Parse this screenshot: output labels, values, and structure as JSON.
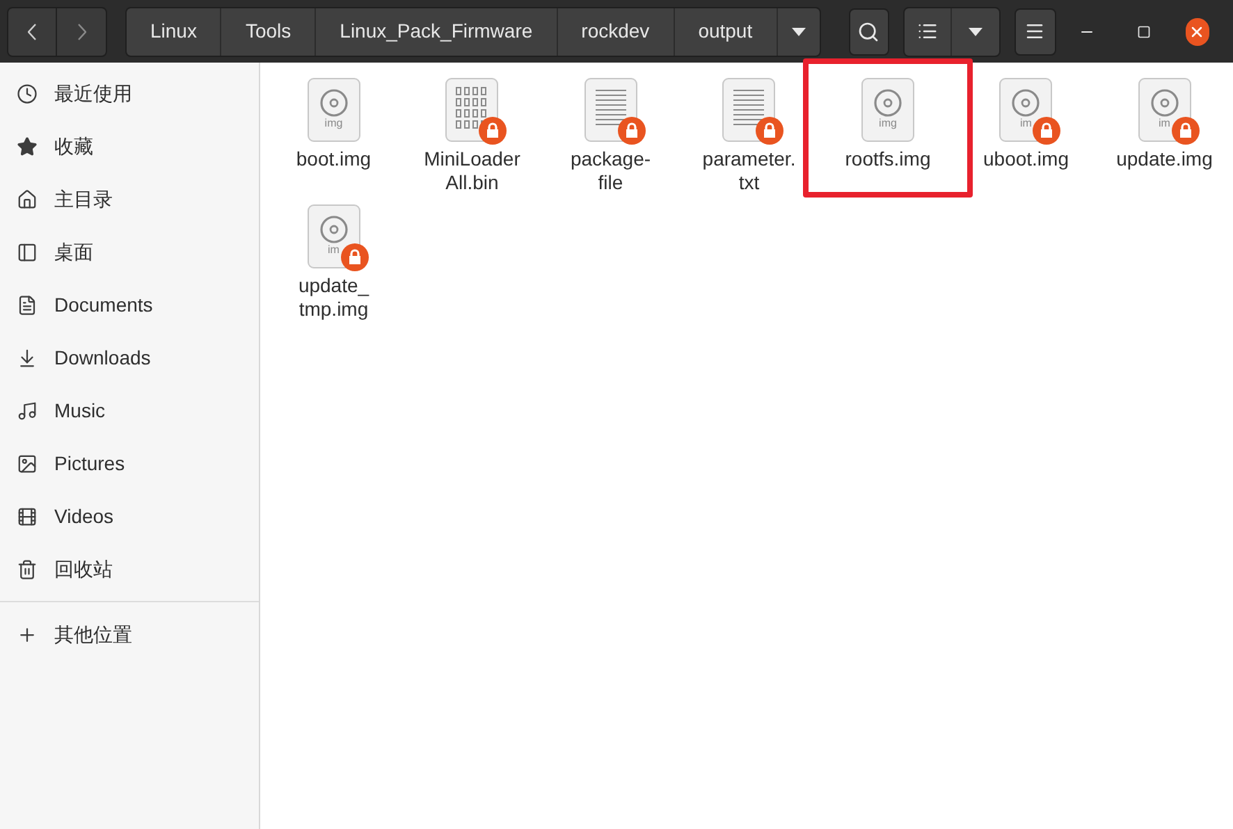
{
  "path_bar": {
    "segments": [
      {
        "label": "Linux"
      },
      {
        "label": "Tools"
      },
      {
        "label": "Linux_Pack_Firmware"
      },
      {
        "label": "rockdev"
      },
      {
        "label": "output"
      }
    ]
  },
  "sidebar": {
    "items": [
      {
        "kind": "recent",
        "label": "最近使用"
      },
      {
        "kind": "starred",
        "label": "收藏"
      },
      {
        "kind": "home",
        "label": "主目录"
      },
      {
        "kind": "desktop",
        "label": "桌面"
      },
      {
        "kind": "documents",
        "label": "Documents"
      },
      {
        "kind": "downloads",
        "label": "Downloads"
      },
      {
        "kind": "music",
        "label": "Music"
      },
      {
        "kind": "pictures",
        "label": "Pictures"
      },
      {
        "kind": "videos",
        "label": "Videos"
      },
      {
        "kind": "trash",
        "label": "回收站"
      }
    ],
    "other": {
      "kind": "other",
      "label": "其他位置"
    }
  },
  "files": [
    {
      "kind": "disc",
      "name": "boot.img",
      "badge": "img",
      "locked": false,
      "highlighted": false
    },
    {
      "kind": "binary",
      "name": "MiniLoader All.bin",
      "locked": true,
      "highlighted": false
    },
    {
      "kind": "text",
      "name": "package- file",
      "locked": true,
      "highlighted": false
    },
    {
      "kind": "text",
      "name": "parameter. txt",
      "locked": true,
      "highlighted": false
    },
    {
      "kind": "disc",
      "name": "rootfs.img",
      "badge": "img",
      "locked": false,
      "highlighted": true
    },
    {
      "kind": "disc",
      "name": "uboot.img",
      "badge": "im",
      "locked": true,
      "highlighted": false
    },
    {
      "kind": "disc",
      "name": "update.img",
      "badge": "im",
      "locked": true,
      "highlighted": false
    },
    {
      "kind": "disc",
      "name": "update_ tmp.img",
      "badge": "im",
      "locked": true,
      "highlighted": false
    }
  ]
}
